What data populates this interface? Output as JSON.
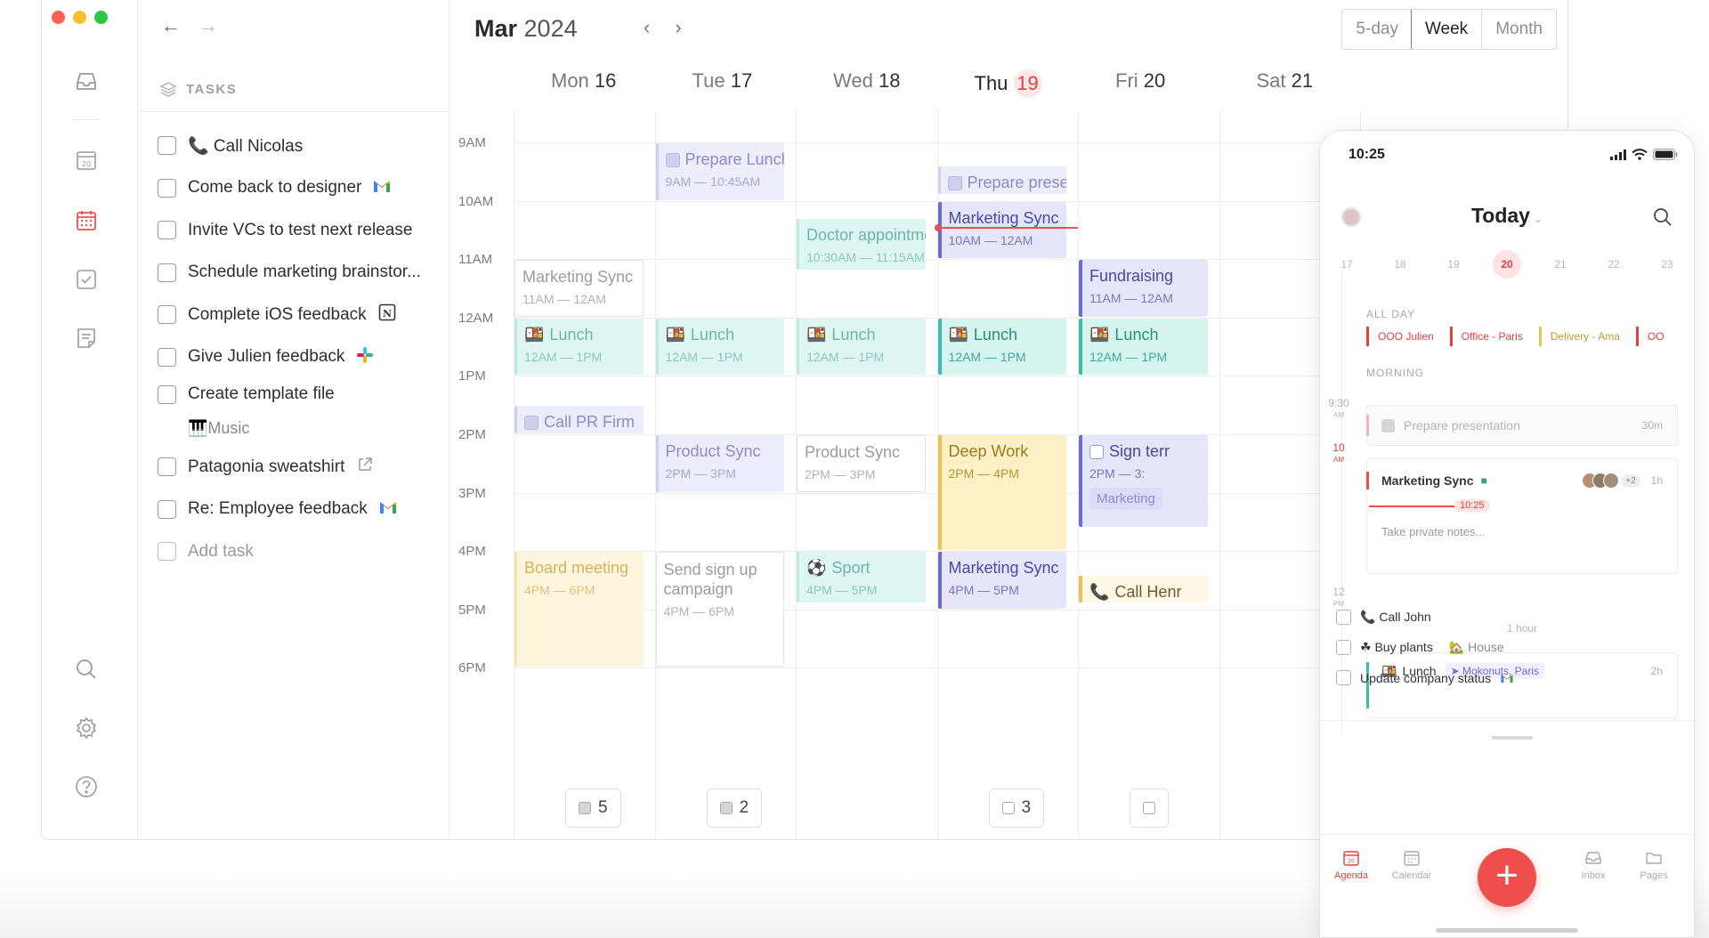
{
  "desktop": {
    "tasks": {
      "header": "TASKS",
      "items": [
        {
          "label": "Call Nicolas",
          "prefix": "📞",
          "tag_icon": "",
          "tag_color": ""
        },
        {
          "label": "Come back to designer",
          "prefix": "",
          "tag_icon": "gmail-icon",
          "tag_color": "#d93025"
        },
        {
          "label": "Invite VCs to test next release",
          "prefix": "",
          "tag_icon": "",
          "tag_color": ""
        },
        {
          "label": "Schedule marketing brainstor...",
          "prefix": "",
          "tag_icon": "",
          "tag_color": ""
        },
        {
          "label": "Complete iOS feedback",
          "prefix": "",
          "tag_icon": "notion-icon",
          "tag_color": "#333333"
        },
        {
          "label": "Give Julien feedback",
          "prefix": "",
          "tag_icon": "slack-icon",
          "tag_color": "#36c5f0"
        },
        {
          "label": "Create template file",
          "prefix": "",
          "tag_icon": "",
          "tag_color": "",
          "sub": "Music"
        },
        {
          "label": "Patagonia sweatshirt",
          "prefix": "",
          "tag_icon": "external-link-icon",
          "tag_color": "#9a9a9a"
        },
        {
          "label": "Re: Employee feedback",
          "prefix": "",
          "tag_icon": "gmail-icon",
          "tag_color": "#d93025"
        }
      ],
      "add_label": "Add task"
    },
    "calendar": {
      "month": "Mar",
      "year": "2024",
      "views": [
        "5-day",
        "Week",
        "Month"
      ],
      "active_view": "Week",
      "days": [
        {
          "name": "Mon",
          "num": "16"
        },
        {
          "name": "Tue",
          "num": "17"
        },
        {
          "name": "Wed",
          "num": "18"
        },
        {
          "name": "Thu",
          "num": "19",
          "today": true
        },
        {
          "name": "Fri",
          "num": "20"
        },
        {
          "name": "Sat",
          "num": "21"
        }
      ],
      "hours": [
        "9AM",
        "10AM",
        "11AM",
        "12AM",
        "1PM",
        "2PM",
        "3PM",
        "4PM",
        "5PM",
        "6PM"
      ],
      "events": [
        {
          "day": 1,
          "title": "Prepare Lunch",
          "time": "9AM — 10:45AM",
          "start": 9.0,
          "end": 10.0,
          "style": "purple",
          "checkbox": true
        },
        {
          "day": 3,
          "title": "Prepare presenta",
          "time": "",
          "start": 9.4,
          "end": 9.9,
          "style": "purple",
          "checkbox": true
        },
        {
          "day": 3,
          "title": "Marketing Sync",
          "time": "10AM — 12AM",
          "start": 10.0,
          "end": 11.0,
          "style": "purple strong"
        },
        {
          "day": 2,
          "title": "Doctor appointment",
          "time": "10:30AM — 11:15AM",
          "start": 10.3,
          "end": 11.2,
          "style": "teal"
        },
        {
          "day": 0,
          "title": "Marketing Sync",
          "time": "11AM — 12AM",
          "start": 11.0,
          "end": 12.0,
          "style": "gray"
        },
        {
          "day": 4,
          "title": "Fundraising",
          "time": "11AM — 12AM",
          "start": 11.0,
          "end": 12.0,
          "style": "purple strong"
        },
        {
          "day": 0,
          "title": "Lunch",
          "time": "12AM — 1PM",
          "start": 12.0,
          "end": 13.0,
          "style": "teal",
          "emoji": true
        },
        {
          "day": 1,
          "title": "Lunch",
          "time": "12AM — 1PM",
          "start": 12.0,
          "end": 13.0,
          "style": "teal",
          "emoji": true
        },
        {
          "day": 2,
          "title": "Lunch",
          "time": "12AM — 1PM",
          "start": 12.0,
          "end": 13.0,
          "style": "teal",
          "emoji": true
        },
        {
          "day": 3,
          "title": "Lunch",
          "time": "12AM — 1PM",
          "start": 12.0,
          "end": 13.0,
          "style": "teal strong",
          "emoji": true
        },
        {
          "day": 4,
          "title": "Lunch",
          "time": "12AM — 1PM",
          "start": 12.0,
          "end": 13.0,
          "style": "teal strong",
          "emoji": true
        },
        {
          "day": 0,
          "title": "Call PR Firm",
          "time": "",
          "start": 13.5,
          "end": 14.0,
          "style": "purple",
          "checkbox": true
        },
        {
          "day": 1,
          "title": "Product Sync",
          "time": "2PM — 3PM",
          "start": 14.0,
          "end": 15.0,
          "style": "purple"
        },
        {
          "day": 2,
          "title": "Product Sync",
          "time": "2PM — 3PM",
          "start": 14.0,
          "end": 15.0,
          "style": "gray"
        },
        {
          "day": 3,
          "title": "Deep Work",
          "time": "2PM — 4PM",
          "start": 14.0,
          "end": 16.0,
          "style": "yellow strong"
        },
        {
          "day": 4,
          "title": "Sign terr",
          "time": "2PM — 3:",
          "start": 14.0,
          "end": 15.6,
          "style": "purple strong",
          "checkbox": "empty",
          "chip": "Marketing"
        },
        {
          "day": 0,
          "title": "Board meeting",
          "time": "4PM — 6PM",
          "start": 16.0,
          "end": 18.0,
          "style": "yellow"
        },
        {
          "day": 1,
          "title": "Send sign up campaign",
          "time": "4PM — 6PM",
          "start": 16.0,
          "end": 18.0,
          "style": "gray",
          "wrap": true
        },
        {
          "day": 2,
          "title": "Sport",
          "time": "4PM — 5PM",
          "start": 16.0,
          "end": 16.9,
          "style": "teal",
          "emoji_sport": true
        },
        {
          "day": 3,
          "title": "Marketing Sync",
          "time": "4PM — 5PM",
          "start": 16.0,
          "end": 17.0,
          "style": "purple strong"
        },
        {
          "day": 4,
          "title": "Call Henr",
          "time": "",
          "start": 16.4,
          "end": 16.9,
          "style": "tan",
          "phone": true
        }
      ],
      "task_counts": [
        {
          "day": 0,
          "count": "5",
          "checked": true
        },
        {
          "day": 1,
          "count": "2",
          "checked": true
        },
        {
          "day": 3,
          "count": "3",
          "checked": false
        },
        {
          "day": 4,
          "count": "",
          "checked": false
        }
      ]
    }
  },
  "phone": {
    "time": "10:25",
    "title": "Today",
    "search_icon": "search-icon",
    "week_days": [
      "17",
      "18",
      "19",
      "20",
      "21",
      "22",
      "23"
    ],
    "selected_day": "20",
    "all_day_label": "ALL DAY",
    "all_day": [
      {
        "label": "OOO Julien",
        "color": "#e0403e"
      },
      {
        "label": "Office - Paris",
        "color": "#e0403e"
      },
      {
        "label": "Delivery - Ama",
        "color": "#e9c24f"
      },
      {
        "label": "OO",
        "color": "#e0403e"
      }
    ],
    "morning_label": "MORNING",
    "hour_labels": [
      {
        "h": "9:30",
        "ampm": "AM"
      },
      {
        "h": "10",
        "ampm": "AM"
      },
      {
        "h": "12",
        "ampm": "PM"
      }
    ],
    "duration_label": "1 hour",
    "cards": {
      "prepare": {
        "title": "Prepare presentation",
        "dur": "30m"
      },
      "sync": {
        "title": "Marketing Sync",
        "dur": "1h",
        "extra": "+2",
        "now": "10:25",
        "notes": "Take private notes..."
      },
      "lunch": {
        "title": "Lunch",
        "location": "Mokonuts, Paris",
        "dur": "2h"
      }
    },
    "tasks": [
      {
        "label": "Call John",
        "prefix": "📞",
        "sub": ""
      },
      {
        "label": "Buy plants",
        "prefix": "☘",
        "sub": "House"
      },
      {
        "label": "Update company status",
        "prefix": "",
        "sub": ""
      }
    ],
    "tabs": [
      {
        "label": "Agenda",
        "active": true
      },
      {
        "label": "Calendar",
        "active": false
      },
      {
        "label": "Inbox",
        "active": false
      },
      {
        "label": "Pages",
        "active": false
      }
    ]
  }
}
